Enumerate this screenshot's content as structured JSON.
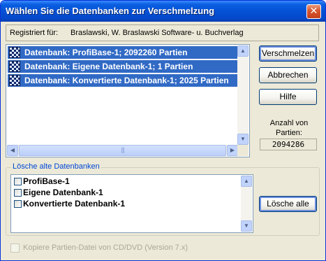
{
  "window": {
    "title": "Wählen Sie die Datenbanken zur Verschmelzung",
    "close_glyph": "✕"
  },
  "registration": {
    "label": "Registriert für:",
    "value": "Braslawski, W. Braslawski Software- u. Buchverlag"
  },
  "databases": [
    {
      "label": "Datenbank: ProfiBase-1; 2092260 Partien",
      "selected": true
    },
    {
      "label": "Datenbank: Eigene Datenbank-1; 1 Partien",
      "selected": true
    },
    {
      "label": "Datenbank: Konvertierte Datenbank-1; 2025 Partien",
      "selected": true
    }
  ],
  "buttons": {
    "merge": "Verschmelzen",
    "cancel": "Abbrechen",
    "help": "Hilfe",
    "delete_all": "Lösche alle"
  },
  "count": {
    "label": "Anzahl von Partien:",
    "value": "2094286"
  },
  "delete_group": {
    "legend": "Lösche alte Datenbanken",
    "items": [
      {
        "label": "ProfiBase-1",
        "checked": false
      },
      {
        "label": "Eigene Datenbank-1",
        "checked": false
      },
      {
        "label": "Konvertierte Datenbank-1",
        "checked": false
      }
    ]
  },
  "copy_option": {
    "label": "Kopiere Partien-Datei von CD/DVD (Version 7.x)",
    "checked": false,
    "enabled": false
  },
  "colors": {
    "title_bar": "#0551d6",
    "selection": "#316ac5",
    "group_legend": "#0046d5"
  },
  "icons": [
    "database-icon",
    "close-icon",
    "scroll-up-icon",
    "scroll-down-icon",
    "scroll-left-icon",
    "scroll-right-icon",
    "checkbox-icon"
  ]
}
